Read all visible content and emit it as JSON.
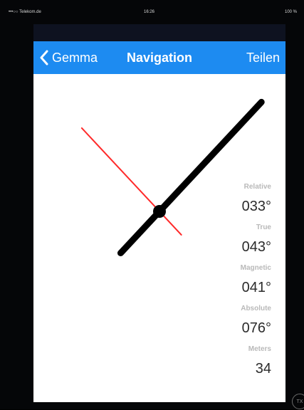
{
  "status_bar": {
    "carrier": "•••○○ Telekom.de",
    "time": "16:26",
    "battery": "100 %"
  },
  "nav": {
    "back_label": "Gemma",
    "title": "Navigation",
    "share_label": "Teilen"
  },
  "compass": {
    "relative_bearing_deg": 33,
    "true_bearing_deg": 43,
    "needle_color": "#000000",
    "pointer_color": "#ff2a2a"
  },
  "readouts": [
    {
      "label": "Relative",
      "value": "033°"
    },
    {
      "label": "True",
      "value": "043°"
    },
    {
      "label": "Magnetic",
      "value": "041°"
    },
    {
      "label": "Absolute",
      "value": "076°"
    },
    {
      "label": "Meters",
      "value": "34"
    }
  ],
  "corner_badge": "TX",
  "colors": {
    "nav_bar": "#1d8bf1",
    "label_gray": "#b9b9b9",
    "value_dark": "#2b2b2b"
  }
}
